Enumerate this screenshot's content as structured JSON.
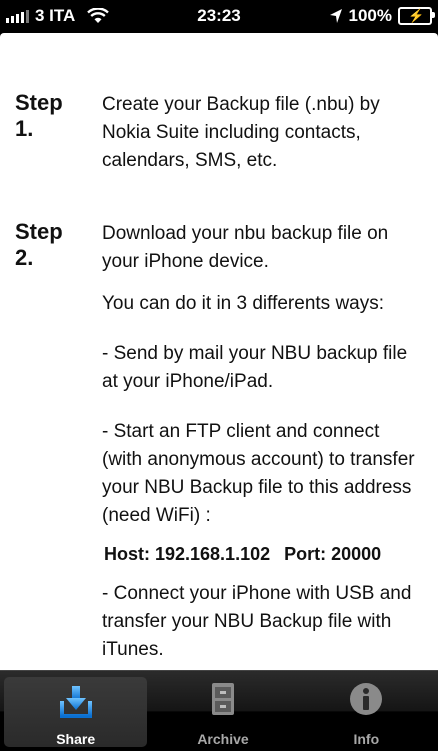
{
  "status_bar": {
    "carrier": "3 ITA",
    "time": "23:23",
    "battery": "100%"
  },
  "steps": [
    {
      "label": "Step 1.",
      "paragraphs": [
        "Create your Backup file (.nbu) by Nokia Suite including contacts, calendars, SMS, etc."
      ]
    },
    {
      "label": "Step 2.",
      "paragraphs": [
        "Download your nbu backup file on your iPhone device.",
        "You can do it in 3 differents ways:",
        "- Send by mail your NBU backup file at your iPhone/iPad.",
        "- Start an FTP client and connect (with anonymous account) to transfer your NBU Backup file to this address (need WiFi) :"
      ],
      "host_label": "Host: 192.168.1.102",
      "port_label": "Port: 20000",
      "final_paragraph": "- Connect your iPhone with USB and transfer your NBU Backup file with iTunes."
    }
  ],
  "tabs": [
    {
      "label": "Share",
      "icon": "download-tray-icon",
      "active": true
    },
    {
      "label": "Archive",
      "icon": "file-cabinet-icon",
      "active": false
    },
    {
      "label": "Info",
      "icon": "info-icon",
      "active": false
    }
  ],
  "colors": {
    "accent": "#1e8de8"
  }
}
